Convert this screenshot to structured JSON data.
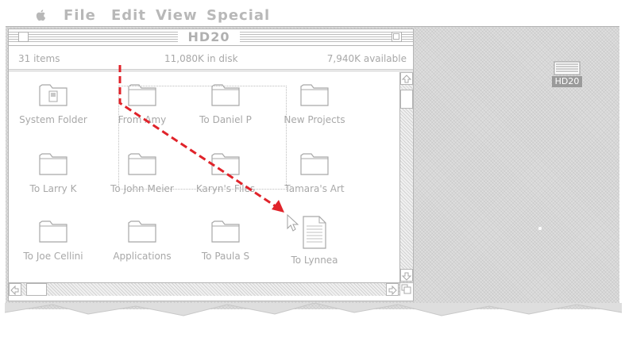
{
  "menubar": {
    "apple_menu": "apple-icon",
    "items": [
      "File",
      "Edit",
      "View",
      "Special"
    ]
  },
  "window": {
    "title": "HD20",
    "info": {
      "items_count": "31 items",
      "in_disk": "11,080K in disk",
      "available": "7,940K available"
    },
    "icons": [
      {
        "label": "System Folder",
        "icon": "system-folder-icon"
      },
      {
        "label": "From Amy",
        "icon": "folder-icon"
      },
      {
        "label": "To Daniel P",
        "icon": "folder-icon"
      },
      {
        "label": "New Projects",
        "icon": "folder-icon"
      },
      {
        "label": "To Larry K",
        "icon": "folder-icon"
      },
      {
        "label": "To John Meier",
        "icon": "folder-icon"
      },
      {
        "label": "Karyn's Files",
        "icon": "folder-icon"
      },
      {
        "label": "Tamara's Art",
        "icon": "folder-icon"
      },
      {
        "label": "To Joe Cellini",
        "icon": "folder-icon"
      },
      {
        "label": "Applications",
        "icon": "folder-icon"
      },
      {
        "label": "To Paula S",
        "icon": "folder-icon"
      },
      {
        "label": "To Lynnea",
        "icon": "document-icon"
      }
    ]
  },
  "desktop": {
    "disk_label": "HD20"
  },
  "colors": {
    "drag_arrow": "#e0232a",
    "ui_gray": "#b0b0b0",
    "desktop": "#dedede"
  }
}
